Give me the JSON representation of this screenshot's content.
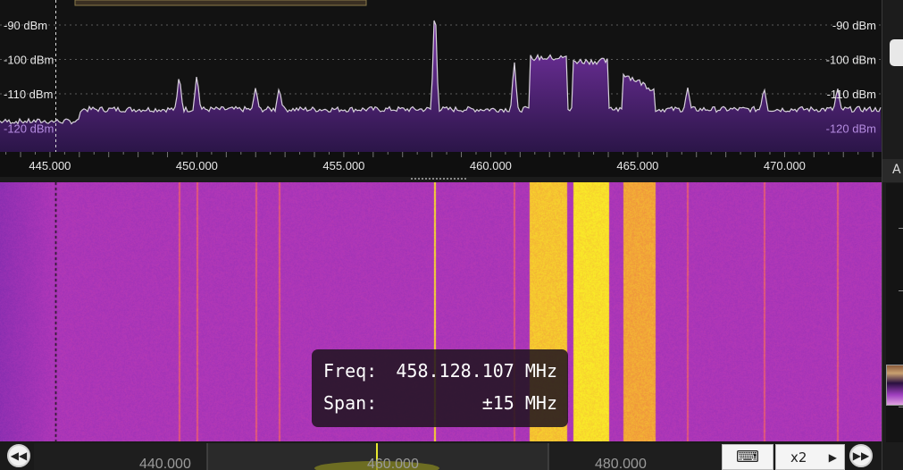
{
  "spectrum": {
    "power_labels": [
      "-90 dBm",
      "-100 dBm",
      "-110 dBm",
      "-120 dBm"
    ],
    "power_levels_dbm": [
      -90,
      -100,
      -110,
      -120
    ],
    "freq_labels": [
      "445.000",
      "450.000",
      "455.000",
      "460.000",
      "465.000",
      "470.000"
    ],
    "freq_values_mhz": [
      445,
      450,
      455,
      460,
      465,
      470
    ],
    "view_range_mhz": [
      443.3,
      473.3
    ],
    "marker_freq_mhz": 445.2,
    "peaks_mhz": [
      449.4,
      450.0,
      452.0,
      452.8,
      458.1,
      460.8,
      463.1,
      464.7,
      466.7,
      469.3,
      471.8
    ],
    "channels_mhz": [
      [
        461.3,
        462.6
      ],
      [
        462.8,
        464.0
      ],
      [
        464.5,
        465.6
      ]
    ]
  },
  "tooltip": {
    "freq_label": "Freq:",
    "freq_value": "458.128.107 MHz",
    "span_label": "Span:",
    "span_value": "±15 MHz"
  },
  "overview": {
    "labels": [
      "440.000",
      "460.000",
      "480.000"
    ],
    "prev_icon": "rewind-icon",
    "next_icon": "fast-forward-icon",
    "keyboard_icon": "keyboard-icon",
    "zoom_label": "x2"
  },
  "right_panel": {
    "top_label": "A"
  },
  "colors": {
    "trace": "#d8d2dc",
    "fill_top": "#6b2a92",
    "fill_bottom": "#2a1447",
    "waterfall_base": "#a63cb8",
    "waterfall_hot": "#f3e21e",
    "text_axis": "#e8e8e8",
    "text_low": "#b48be0"
  }
}
